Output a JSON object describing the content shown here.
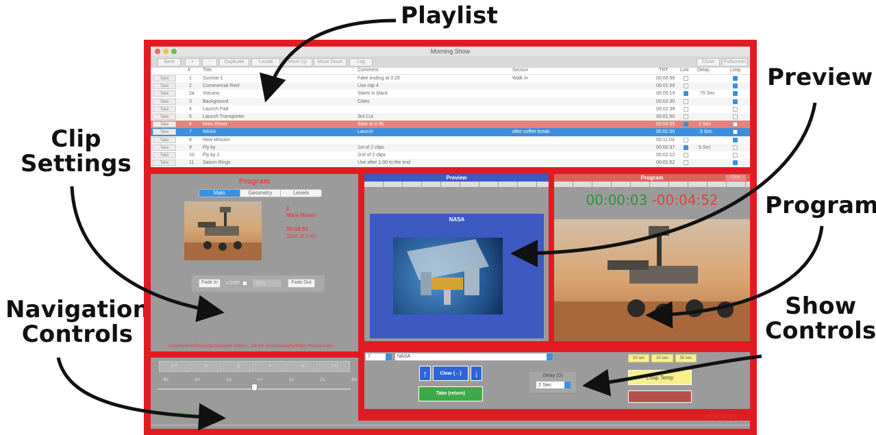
{
  "annotations": {
    "playlist": "Playlist",
    "preview": "Preview",
    "clip_settings_1": "Clip",
    "clip_settings_2": "Settings",
    "program": "Program",
    "navigation_1": "Navigation",
    "navigation_2": "Controls",
    "show_controls_1": "Show",
    "show_controls_2": "Controls"
  },
  "window": {
    "title": "Morning Show"
  },
  "toolbar": {
    "save": "Save",
    "add": "+",
    "remove": "-",
    "duplicate": "Duplicate",
    "locate": "Locate",
    "move_up": "Move Up",
    "move_down": "Move Down",
    "log": "Log",
    "close": "Close",
    "fullscreen": "Fullscreen"
  },
  "playlist": {
    "columns": {
      "num": "#",
      "title": "Title",
      "comment": "Comment",
      "section": "Section",
      "trt": "TRT",
      "link": "Link",
      "delay": "Delay",
      "loop": "Loop"
    },
    "rows": [
      {
        "take": "Take",
        "num": "1",
        "title": "Sunrise 1",
        "comment": "Fake ending at 0:20",
        "section": "Walk In",
        "trt": "00:00:59",
        "delay": "",
        "link": false,
        "loop": true
      },
      {
        "take": "Take",
        "num": "2",
        "title": "Commercial Reel",
        "comment": "Use clip 4",
        "section": "",
        "trt": "00:01:59",
        "delay": "",
        "link": false,
        "loop": true
      },
      {
        "take": "Take",
        "num": "2a",
        "title": "Volcano",
        "comment": "Starts in black",
        "section": "",
        "trt": "00:05:19",
        "delay": ".75 Sec",
        "link": true,
        "loop": true
      },
      {
        "take": "Take",
        "num": "3",
        "title": "Background",
        "comment": "Cities",
        "section": "",
        "trt": "00:02:30",
        "delay": "",
        "link": false,
        "loop": true
      },
      {
        "take": "Take",
        "num": "4",
        "title": "Launch Pad",
        "comment": "",
        "section": "",
        "trt": "00:02:39",
        "delay": "",
        "link": false,
        "loop": false
      },
      {
        "take": "Take",
        "num": "5",
        "title": "Launch Transporter",
        "comment": "3rd Cut",
        "section": "",
        "trt": "00:01:50",
        "delay": "",
        "link": false,
        "loop": false
      },
      {
        "take": "Take",
        "num": "6",
        "title": "Mars Rover",
        "comment": "Start at 0:45",
        "section": "",
        "trt": "00:04:55",
        "delay": "2 Sec",
        "link": true,
        "loop": false
      },
      {
        "take": "Take",
        "num": "7",
        "title": "NASA",
        "comment": "Launch",
        "section": "after coffee break",
        "trt": "00:01:00",
        "delay": ".5 Sec",
        "link": true,
        "loop": false
      },
      {
        "take": "Take",
        "num": "8",
        "title": "New Mission",
        "comment": "",
        "section": "",
        "trt": "00:11:03",
        "delay": "",
        "link": false,
        "loop": true
      },
      {
        "take": "Take",
        "num": "9",
        "title": "Fly by",
        "comment": "1st of 2 clips",
        "section": "",
        "trt": "00:00:37",
        "delay": "5 Sec",
        "link": true,
        "loop": false
      },
      {
        "take": "Take",
        "num": "10",
        "title": "Fly by 2",
        "comment": "2nd of 2 clips",
        "section": "",
        "trt": "00:02:12",
        "delay": "",
        "link": false,
        "loop": false
      },
      {
        "take": "Take",
        "num": "11",
        "title": "Saturn Rings",
        "comment": "Use after 1:30 to the end",
        "section": "",
        "trt": "00:01:52",
        "delay": "",
        "link": false,
        "loop": true
      }
    ]
  },
  "clip_settings": {
    "heading": "Program",
    "tabs": [
      "Main",
      "Geometry",
      "Levels"
    ],
    "clip_number": "6",
    "clip_title": "Mars Rover",
    "clip_duration": "00:04:55",
    "clip_comment": "Start at 0:45",
    "fade_in": "Fade In",
    "loop_label": "LOOP",
    "zero_select": "Zero",
    "fade_out": "Fade Out",
    "path": "/Users/test/Desktop/Sample Video...ed for Screenshots/Mars Rover.mov"
  },
  "preview": {
    "heading": "Preview",
    "clip_label": "NASA"
  },
  "program": {
    "heading": "Program",
    "elapsed": "00:00:03",
    "remaining": "-00:04:52",
    "badge": "Clear"
  },
  "navigation": {
    "buttons": [
      "|<<",
      "|<",
      "||",
      ">",
      ">|",
      ">>|"
    ],
    "speeds": [
      "-8x",
      "-2x",
      "-1x",
      "<>",
      "1x",
      "2x",
      "8x"
    ],
    "timecode": "00:00:00:00",
    "total_timecode": "00:04:55:671"
  },
  "show_controls": {
    "clip_number_select": "7",
    "clip_name_select": "NASA",
    "up_arrow": "↑",
    "clear": "Clear (←)",
    "down_arrow": "↓",
    "take": "Take (return)",
    "delay_label": "Delay (D)",
    "delay_value": "2 Sec",
    "time_buttons": [
      "10 sec",
      "20 sec",
      "30 sec"
    ],
    "loop_temp": "Loop Temp"
  },
  "colors": {
    "frame": "#e21b23",
    "selected_red": "#e5827c",
    "selected_blue": "#3b8fdc",
    "take_green": "#3fa94a",
    "arrow_blue": "#2f63d8"
  }
}
